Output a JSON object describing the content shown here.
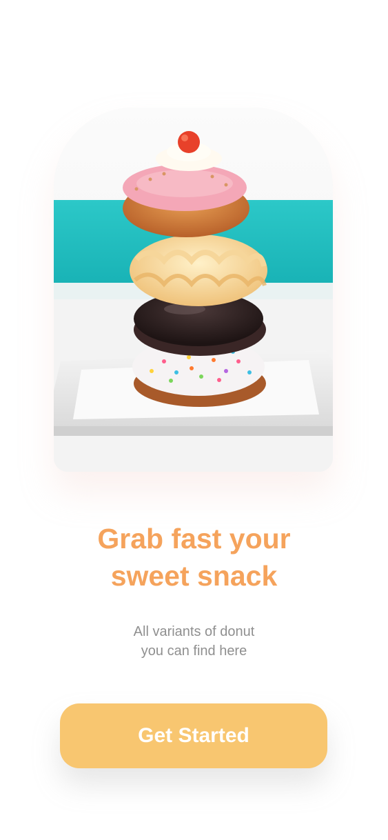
{
  "hero": {
    "image_subject": "stack of four donuts on a white plate"
  },
  "headline": {
    "line1": "Grab fast your",
    "line2": "sweet snack"
  },
  "subtitle": {
    "line1": "All variants of donut",
    "line2": "you can find here"
  },
  "cta": {
    "label": "Get Started"
  },
  "colors": {
    "accent": "#f5a35c",
    "button": "#f8c670",
    "subtitle": "#8f8f8f",
    "background": "#ffffff"
  }
}
